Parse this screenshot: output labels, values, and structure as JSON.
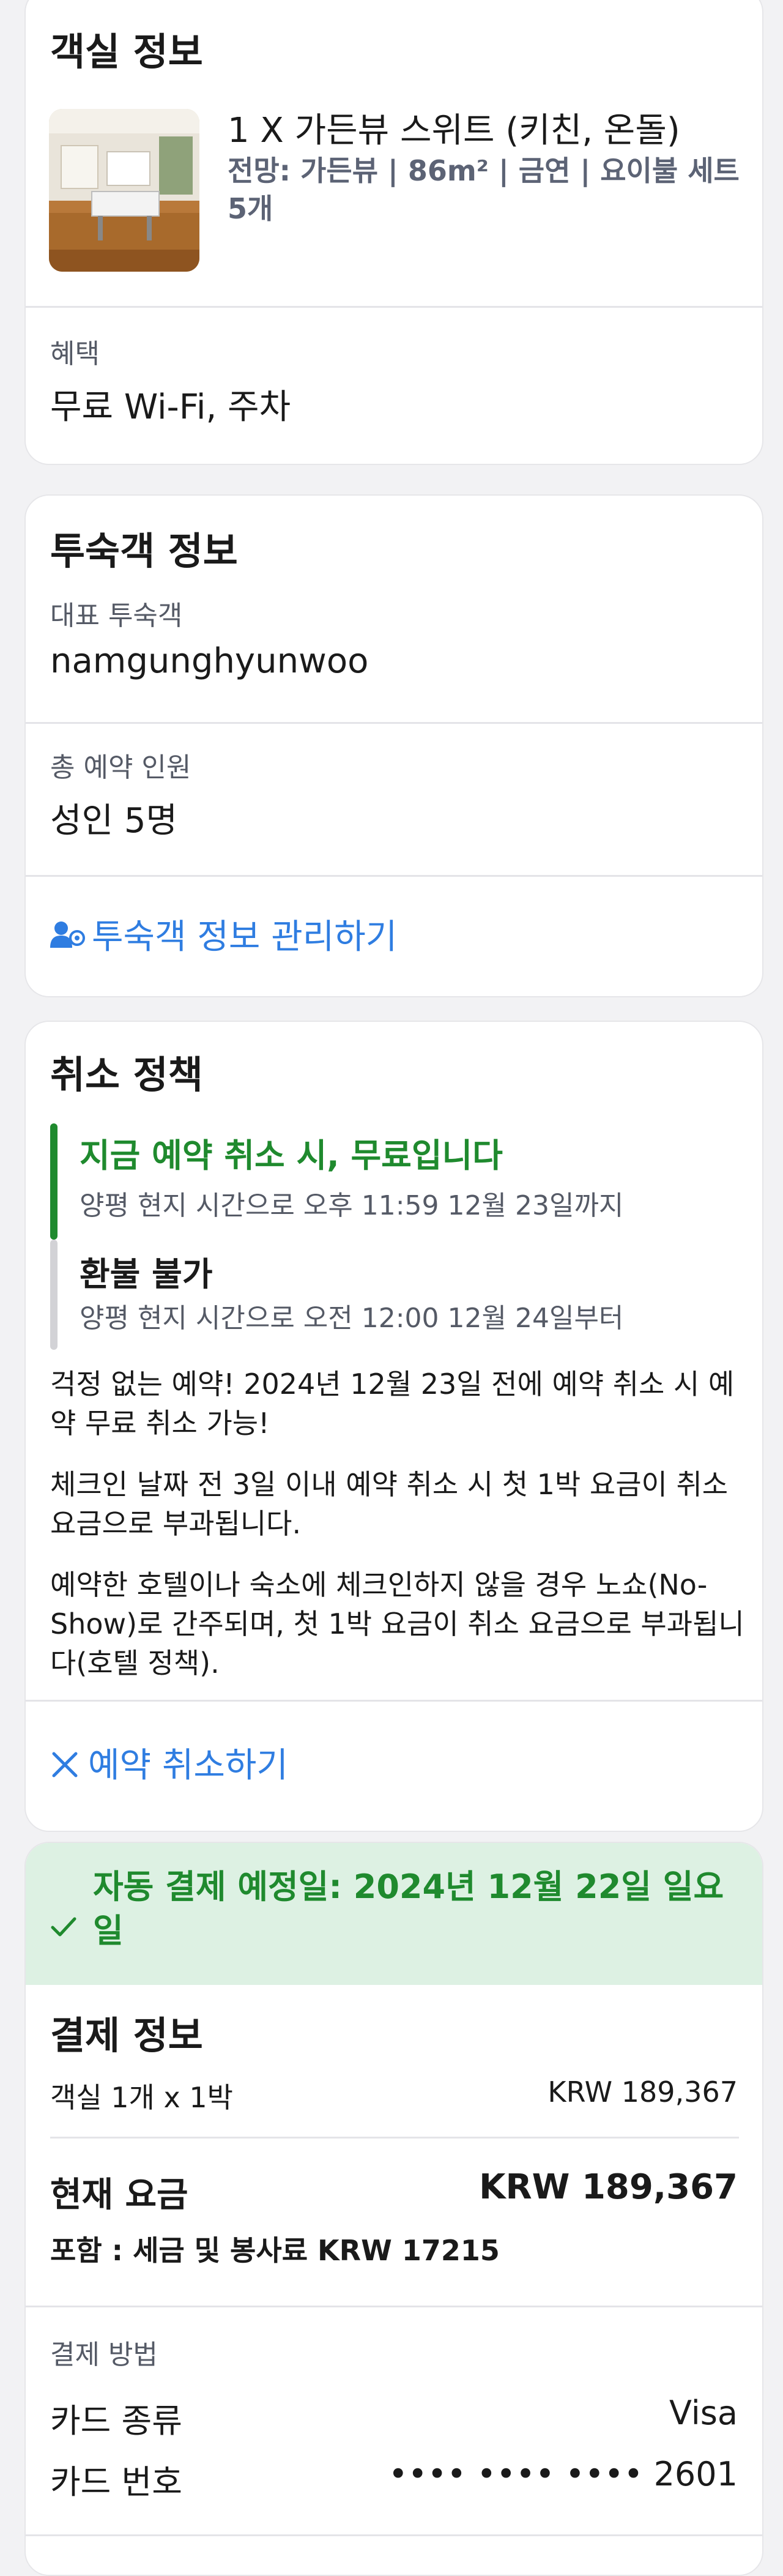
{
  "room": {
    "section_title": "객실 정보",
    "room_name": "1 X 가든뷰 스위트 (키친, 온돌)",
    "room_details": "전망: 가든뷰 | 86m² | 금연 | 요이불 세트 5개",
    "benefits_label": "혜택",
    "benefits_value": "무료 Wi-Fi, 주차"
  },
  "guest": {
    "section_title": "투숙객 정보",
    "lead_guest_label": "대표 투숙객",
    "lead_guest_value": "namgunghyunwoo",
    "total_guests_label": "총 예약 인원",
    "total_guests_value": "성인 5명",
    "manage_link": "투숙객 정보 관리하기"
  },
  "cancellation": {
    "section_title": "취소 정책",
    "timeline": [
      {
        "title": "지금 예약 취소 시, 무료입니다",
        "subtitle": "양평 현지 시간으로 오후 11:59 12월 23일까지",
        "color": "#1f8a2e"
      },
      {
        "title": "환불 불가",
        "subtitle": "양평 현지 시간으로 오전 12:00 12월 24일부터",
        "color": "#d2d2d6"
      }
    ],
    "notes": [
      "걱정 없는 예약! 2024년 12월 23일 전에 예약 취소 시 예약 무료 취소 가능!",
      "체크인 날짜 전 3일 이내 예약 취소 시 첫 1박 요금이 취소 요금으로 부과됩니다.",
      "예약한 호텔이나 숙소에 체크인하지 않을 경우 노쇼(No-Show)로 간주되며, 첫 1박 요금이 취소 요금으로 부과됩니다(호텔 정책)."
    ],
    "cancel_link": "예약 취소하기"
  },
  "payment": {
    "auto_payment_banner": "자동 결제 예정일: 2024년 12월 22일 일요일",
    "section_title": "결제 정보",
    "room_line_label": "객실 1개 x 1박",
    "room_line_value": "KRW 189,367",
    "current_total_label": "현재 요금",
    "current_total_value": "KRW 189,367",
    "tax_note": "포함 : 세금 및 봉사료 KRW 17215",
    "method_label": "결제 방법",
    "card_type_label": "카드 종류",
    "card_type_value": "Visa",
    "card_number_label": "카드 번호",
    "card_number_value": "•••• •••• •••• 2601"
  },
  "colors": {
    "link_blue": "#2f7de1",
    "success_green": "#1f8a2e",
    "banner_bg": "#ddf1e3",
    "details_gray": "#5c6375"
  },
  "icons": [
    "room-photo",
    "manage-guests-icon",
    "close-icon",
    "check-icon"
  ]
}
